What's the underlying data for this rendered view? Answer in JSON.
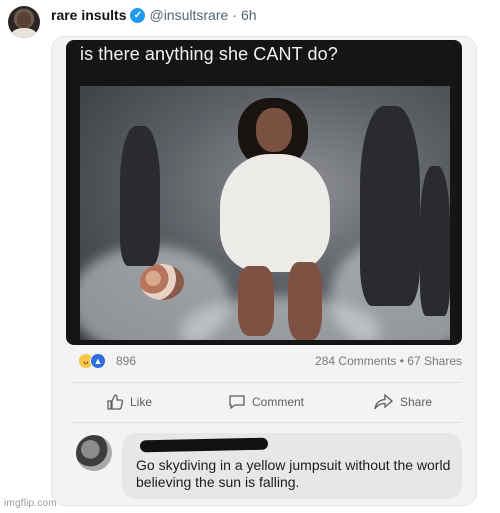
{
  "tweet": {
    "display_name": "rare insults",
    "username": "@insultsrare",
    "separator": "·",
    "time": "6h"
  },
  "meme": {
    "caption": "is there anything she CANT do?"
  },
  "facebook_post": {
    "reaction_count": "896",
    "comments_shares": "284 Comments • 67 Shares",
    "actions": {
      "like": "Like",
      "comment": "Comment",
      "share": "Share"
    },
    "reply_text": "Go skydiving in a yellow jumpsuit without the world believing the sun is falling."
  },
  "watermark": "imgflip.com",
  "colors": {
    "verified_blue": "#1d9bf0",
    "like_blue": "#2d6fe0",
    "haha_yellow": "#f7c64a"
  },
  "icons": [
    "verified-badge-icon",
    "haha-reaction-icon",
    "like-reaction-icon",
    "thumbs-up-icon",
    "comment-icon",
    "share-icon"
  ]
}
